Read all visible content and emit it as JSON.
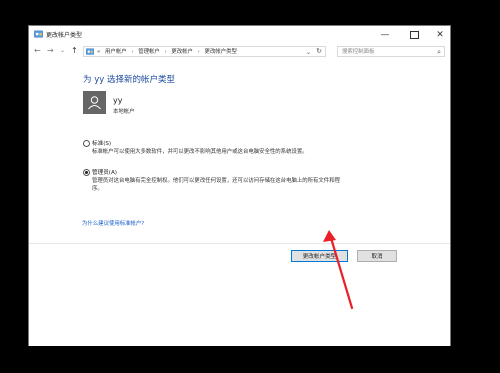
{
  "window": {
    "title": "更改帐户类型",
    "controls": {
      "minimize": "—",
      "close": "✕"
    }
  },
  "address_bar": {
    "back": "←",
    "forward": "→",
    "recent": "⌄",
    "up": "↑",
    "overflow": "«",
    "breadcrumbs": [
      "用户帐户",
      "管理帐户",
      "更改帐户",
      "更改帐户类型"
    ],
    "separator": "›",
    "dropdown": "⌄",
    "refresh": "↻",
    "search_placeholder": "搜索控制面板",
    "search_icon": "⌕"
  },
  "main": {
    "heading": "为 yy 选择新的帐户类型",
    "user": {
      "name": "yy",
      "type": "本地帐户"
    },
    "options": [
      {
        "label": "标准(S)",
        "description": "标准帐户可以使用大多数软件，并可以更改不影响其他用户或这台电脑安全性的系统设置。",
        "selected": false
      },
      {
        "label": "管理员(A)",
        "description_line1": "管理员对这台电脑有完全控制权。他们可以更改任何设置，还可以访问存储在这台电脑上的所有文件和程",
        "description_line2": "序。",
        "selected": true
      }
    ],
    "help_link": "为什么建议使用标准帐户?"
  },
  "buttons": {
    "change_type": "更改帐户类型",
    "cancel": "取消"
  },
  "colors": {
    "heading": "#1c4a9c",
    "link": "#1a5fc9",
    "annotation_arrow": "#e8202a"
  }
}
